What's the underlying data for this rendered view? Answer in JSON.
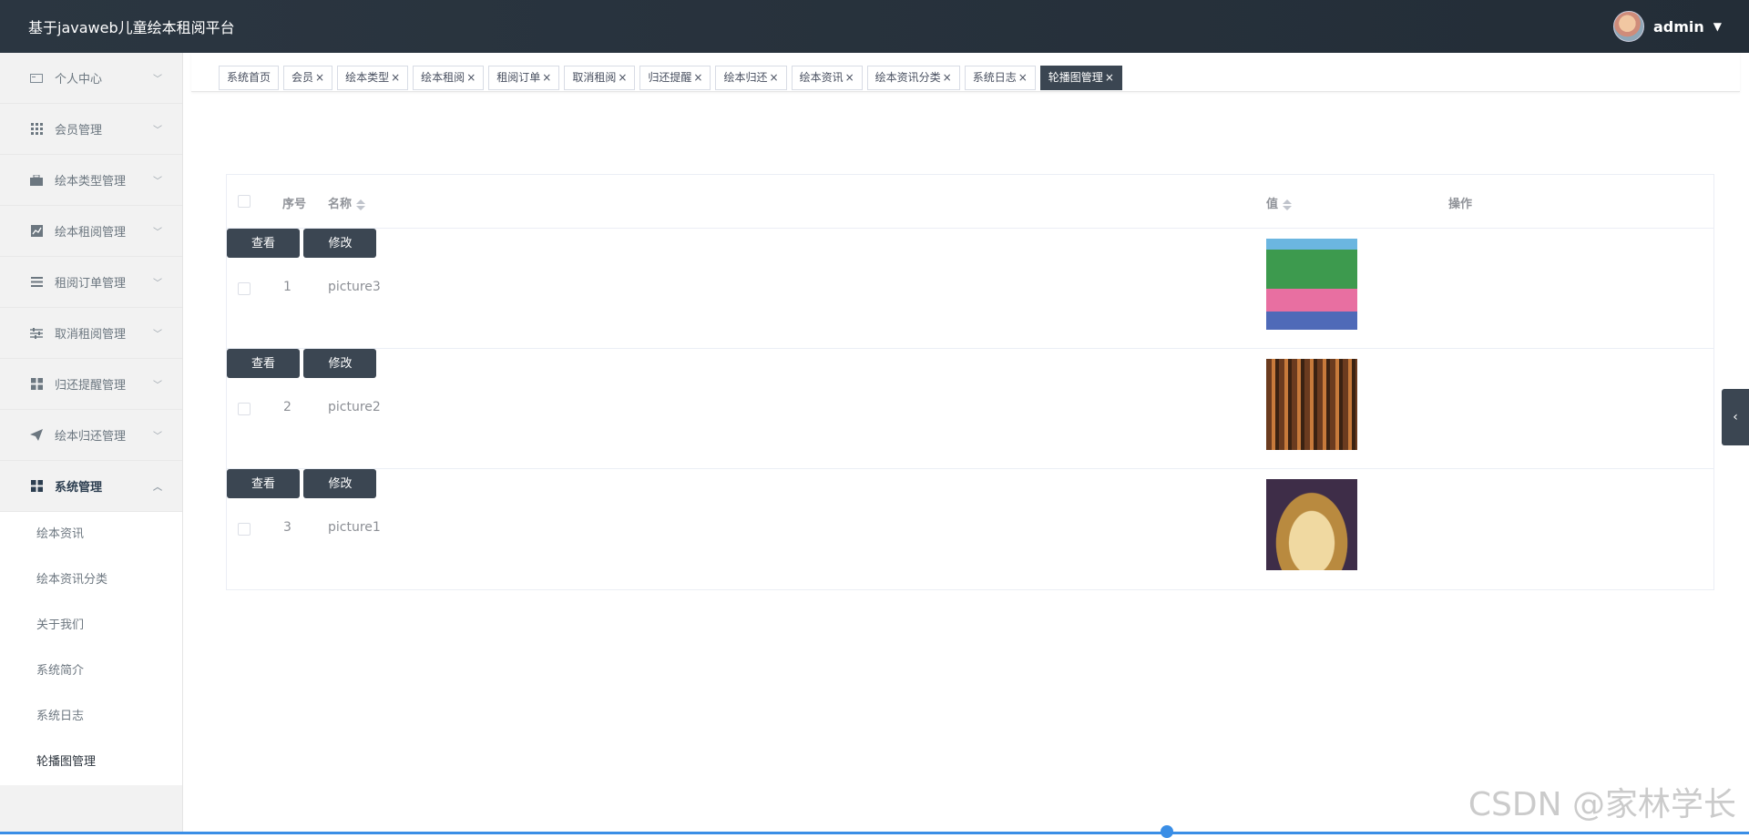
{
  "header": {
    "title": "基于javaweb儿童绘本租阅平台",
    "username": "admin"
  },
  "sidebar": {
    "items": [
      {
        "label": "个人中心",
        "icon": "id-card-icon"
      },
      {
        "label": "会员管理",
        "icon": "grid-icon"
      },
      {
        "label": "绘本类型管理",
        "icon": "briefcase-icon"
      },
      {
        "label": "绘本租阅管理",
        "icon": "chart-icon"
      },
      {
        "label": "租阅订单管理",
        "icon": "list-icon"
      },
      {
        "label": "取消租阅管理",
        "icon": "sliders-icon"
      },
      {
        "label": "归还提醒管理",
        "icon": "apps-icon"
      },
      {
        "label": "绘本归还管理",
        "icon": "paper-plane-icon"
      },
      {
        "label": "系统管理",
        "icon": "apps-icon"
      }
    ],
    "submenu": [
      "绘本资讯",
      "绘本资讯分类",
      "关于我们",
      "系统简介",
      "系统日志",
      "轮播图管理"
    ]
  },
  "tabs": [
    "系统首页",
    "会员",
    "绘本类型",
    "绘本租阅",
    "租阅订单",
    "取消租阅",
    "归还提醒",
    "绘本归还",
    "绘本资讯",
    "绘本资讯分类",
    "系统日志",
    "轮播图管理"
  ],
  "table": {
    "headers": {
      "index": "序号",
      "name": "名称",
      "value": "值",
      "actions": "操作"
    },
    "rows": [
      {
        "index": "1",
        "name": "picture3",
        "image": "book-cover-simple-ai"
      },
      {
        "index": "2",
        "name": "picture2",
        "image": "library-interior"
      },
      {
        "index": "3",
        "name": "picture1",
        "image": "open-book"
      }
    ],
    "view_label": "查看",
    "edit_label": "修改"
  },
  "watermark": "CSDN @家林学长",
  "colors": {
    "header": "#2b3641",
    "button": "#3b4652",
    "accent": "#3a8ee6"
  }
}
